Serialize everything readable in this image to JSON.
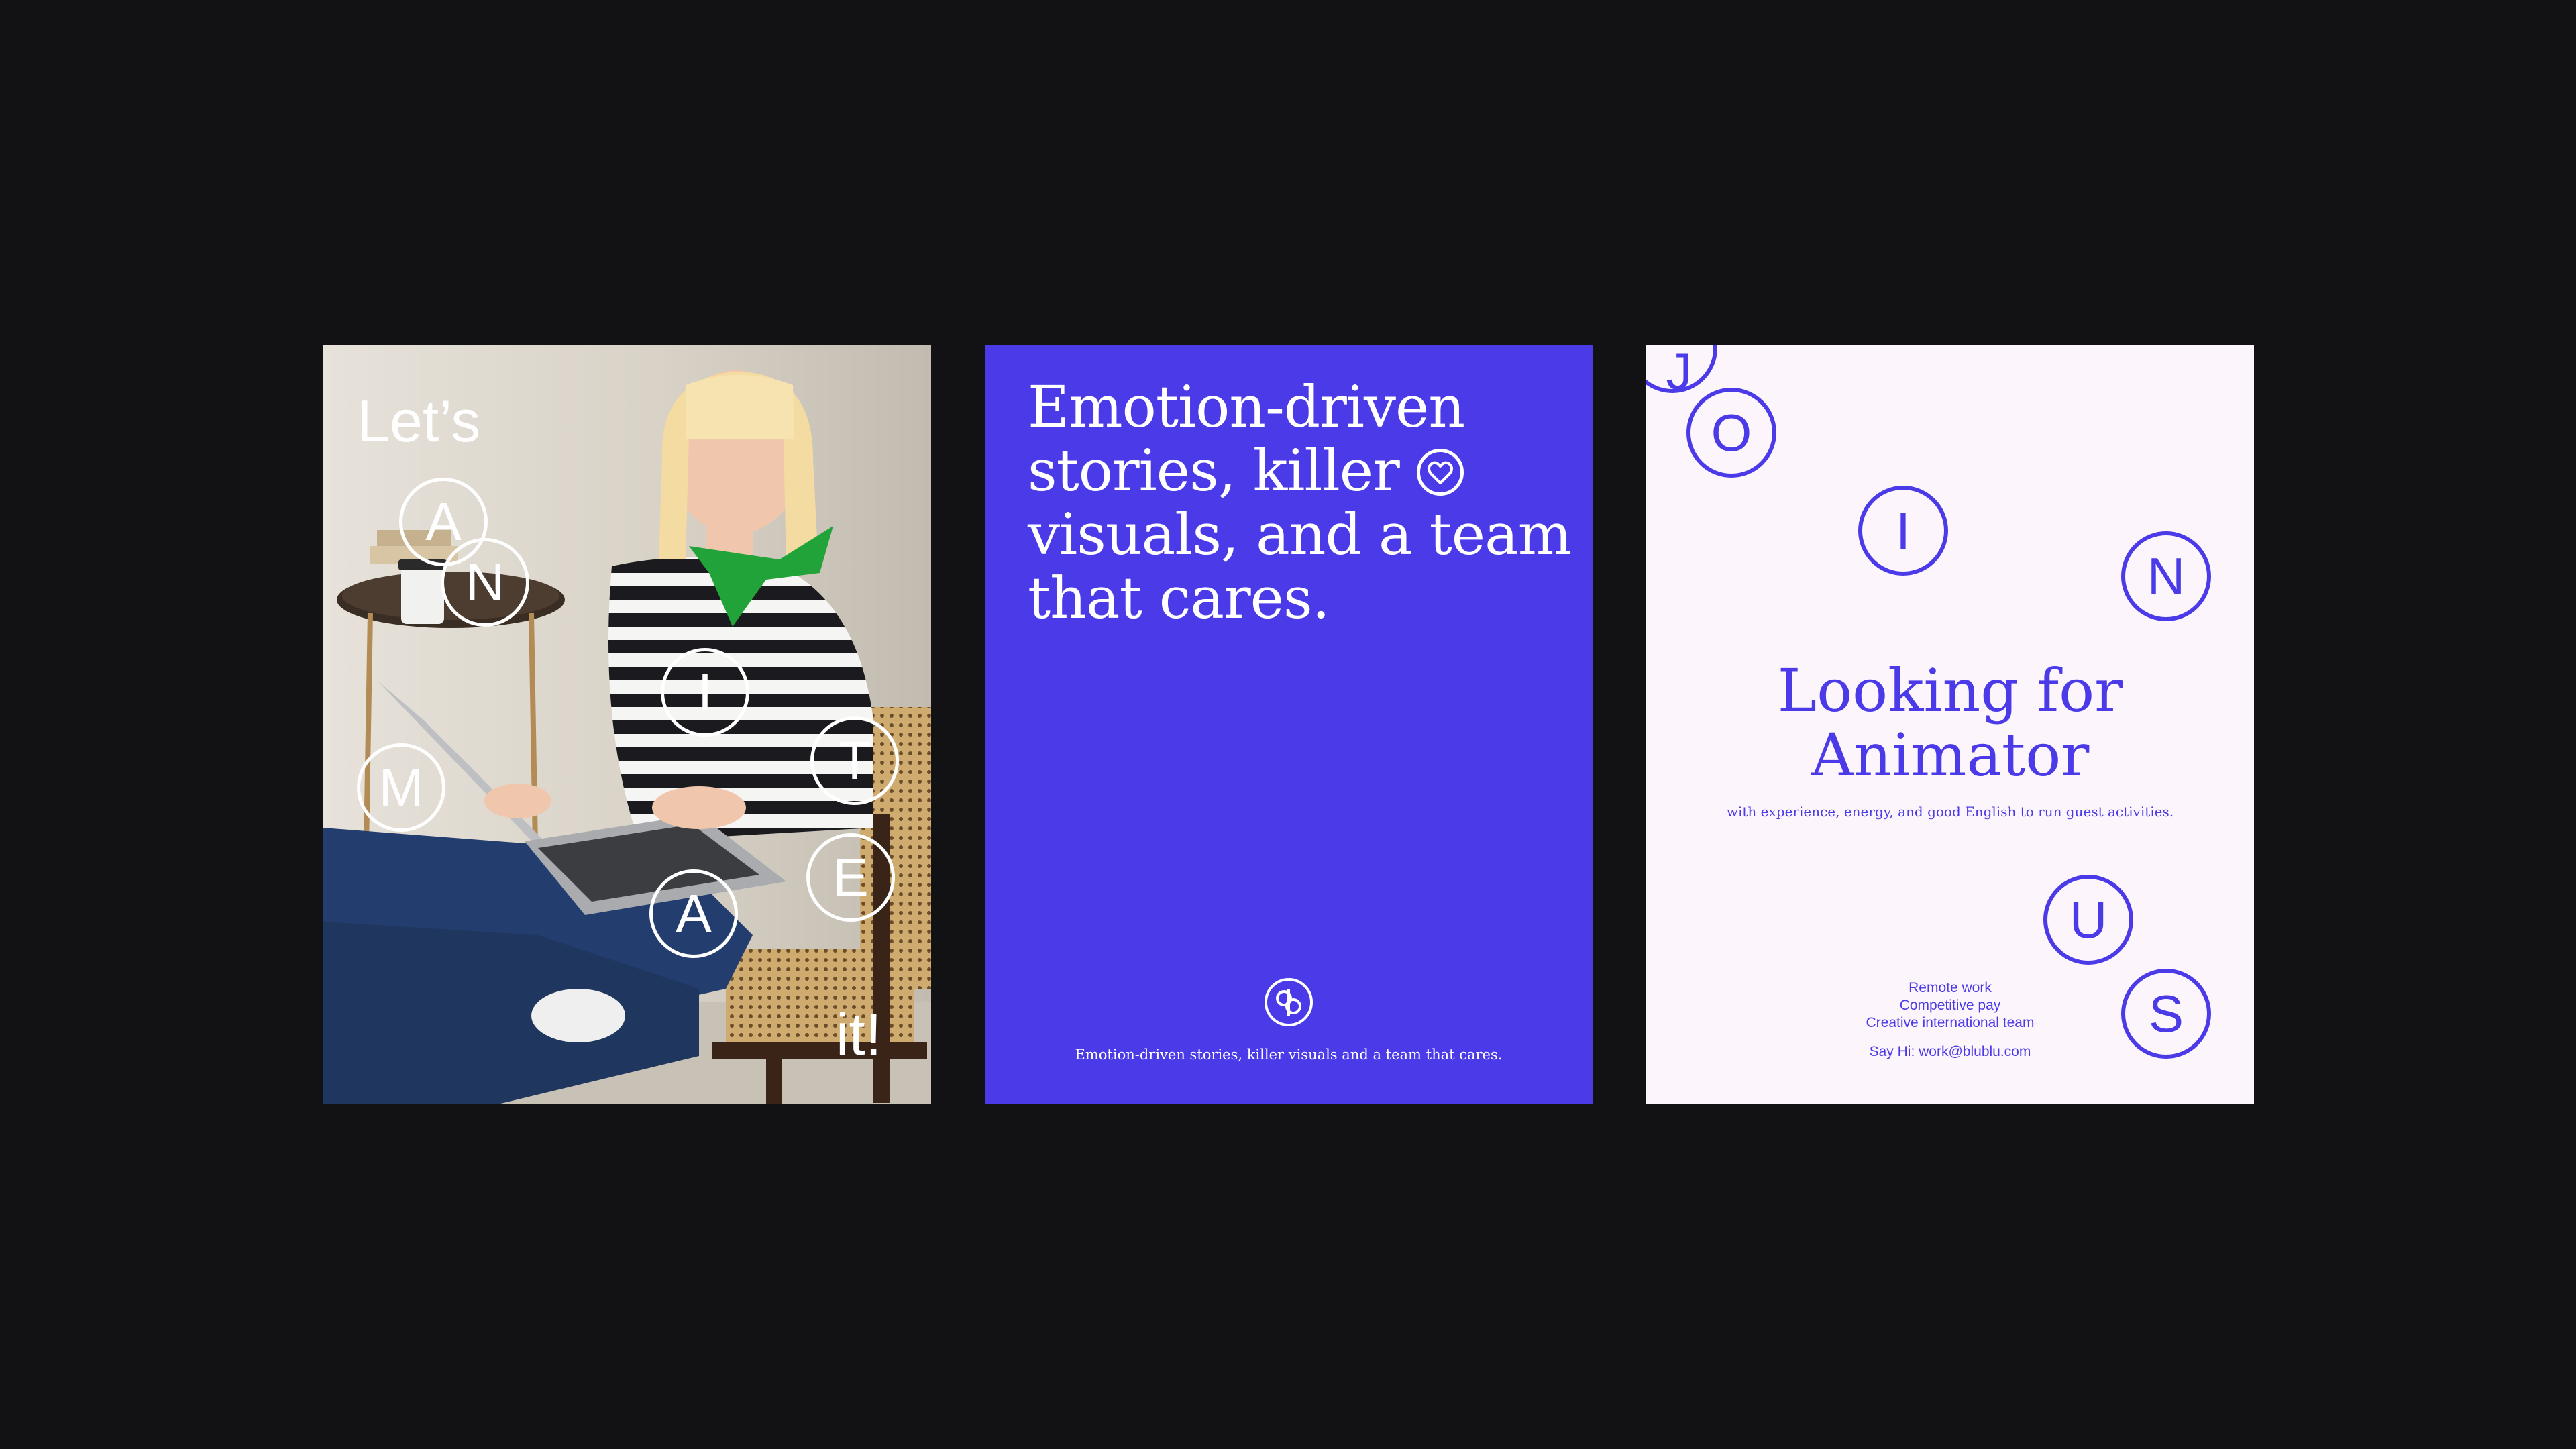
{
  "photo_card": {
    "top_word": "Let’s",
    "bottom_word": "it!",
    "letters": [
      "A",
      "N",
      "I",
      "M",
      "T",
      "E",
      "A"
    ]
  },
  "blue_card": {
    "headline_lines": [
      "Emotion-driven",
      "stories, killer",
      "visuals, and a team",
      "that cares."
    ],
    "caption": "Emotion-driven stories, killer visuals and a team that cares.",
    "logo_icon": "brand-logo-icon",
    "heart_icon": "heart-icon"
  },
  "job_card": {
    "title_lines": [
      "Looking for",
      "Animator"
    ],
    "subtitle": "with experience, energy, and good English to run guest activities.",
    "perks": [
      "Remote work",
      "Competitive pay",
      "Creative international team"
    ],
    "contact": "Say Hi: work@blublu.com",
    "letters": [
      "J",
      "O",
      "I",
      "N",
      "U",
      "S"
    ]
  },
  "colors": {
    "background": "#121214",
    "brand_blue": "#4a3ae8",
    "light_card": "#fdf5fc",
    "scarf_green": "#22a33a"
  }
}
